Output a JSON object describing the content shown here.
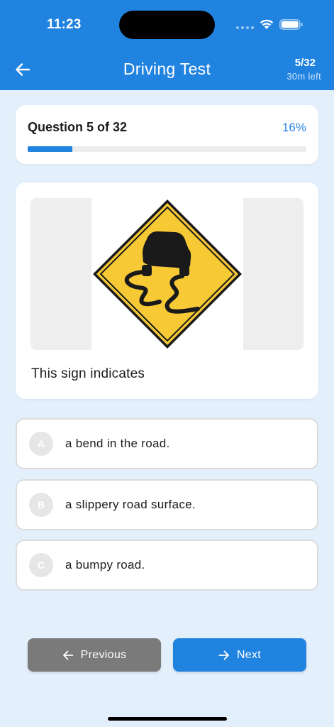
{
  "status_bar": {
    "time": "11:23"
  },
  "header": {
    "title": "Driving Test",
    "progress_count": "5/32",
    "time_left": "30m left"
  },
  "progress": {
    "question_label": "Question 5 of 32",
    "percent_label": "16%",
    "fraction": 0.16
  },
  "question": {
    "image": "slippery-road-warning-sign",
    "text": "This sign indicates"
  },
  "options": [
    {
      "letter": "A",
      "text": "a bend in the road."
    },
    {
      "letter": "B",
      "text": "a slippery road surface."
    },
    {
      "letter": "C",
      "text": "a bumpy road."
    }
  ],
  "nav": {
    "previous_label": "Previous",
    "next_label": "Next"
  },
  "colors": {
    "accent": "#2183e0",
    "background": "#e3effb",
    "sign_yellow": "#f7c935"
  }
}
